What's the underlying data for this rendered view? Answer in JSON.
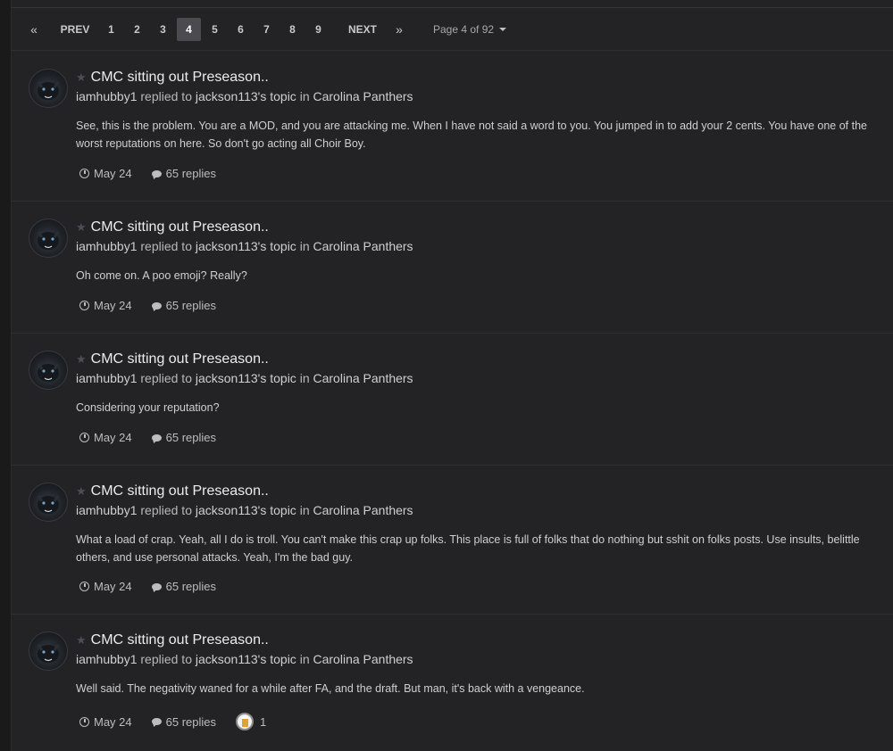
{
  "pagination": {
    "first_icon": "«",
    "prev_label": "PREV",
    "pages": [
      "1",
      "2",
      "3",
      "4",
      "5",
      "6",
      "7",
      "8",
      "9"
    ],
    "current_page": "4",
    "next_label": "NEXT",
    "last_icon": "»",
    "jump_label": "Page 4 of 92"
  },
  "items": [
    {
      "title": "CMC sitting out Preseason..",
      "author": "iamhubby1",
      "action": "replied to",
      "topic_owner": "jackson113's topic",
      "in": "in",
      "forum": "Carolina Panthers",
      "snippet": "See, this is the problem. You are a MOD, and you are attacking me. When I have not said a word to you. You jumped in to add your 2 cents. You have one of the worst reputations on here. So don't go acting all Choir Boy.",
      "date": "May 24",
      "replies": "65 replies"
    },
    {
      "title": "CMC sitting out Preseason..",
      "author": "iamhubby1",
      "action": "replied to",
      "topic_owner": "jackson113's topic",
      "in": "in",
      "forum": "Carolina Panthers",
      "snippet": "Oh come on. A poo emoji? Really?",
      "date": "May 24",
      "replies": "65 replies"
    },
    {
      "title": "CMC sitting out Preseason..",
      "author": "iamhubby1",
      "action": "replied to",
      "topic_owner": "jackson113's topic",
      "in": "in",
      "forum": "Carolina Panthers",
      "snippet": "Considering your reputation?",
      "date": "May 24",
      "replies": "65 replies"
    },
    {
      "title": "CMC sitting out Preseason..",
      "author": "iamhubby1",
      "action": "replied to",
      "topic_owner": "jackson113's topic",
      "in": "in",
      "forum": "Carolina Panthers",
      "snippet": "What a load of crap. Yeah, all I do is troll. You can't make this crap up folks. This place is full of folks that do nothing but sshit on folks posts. Use insults, belittle others, and use personal attacks. Yeah, I'm the bad guy.",
      "date": "May 24",
      "replies": "65 replies"
    },
    {
      "title": "CMC sitting out Preseason..",
      "author": "iamhubby1",
      "action": "replied to",
      "topic_owner": "jackson113's topic",
      "in": "in",
      "forum": "Carolina Panthers",
      "snippet": "Well said. The negativity waned for a while after FA, and the draft. But man, it's back with a vengeance.",
      "date": "May 24",
      "replies": "65 replies",
      "reaction_count": "1"
    }
  ],
  "icons": {
    "star": "star-icon",
    "clock": "clock-icon",
    "comment": "comment-icon",
    "reaction": "beer-reaction-icon"
  },
  "colors": {
    "background": "#232325",
    "active_page": "#4a4a4f",
    "text": "#d7d7d7"
  }
}
